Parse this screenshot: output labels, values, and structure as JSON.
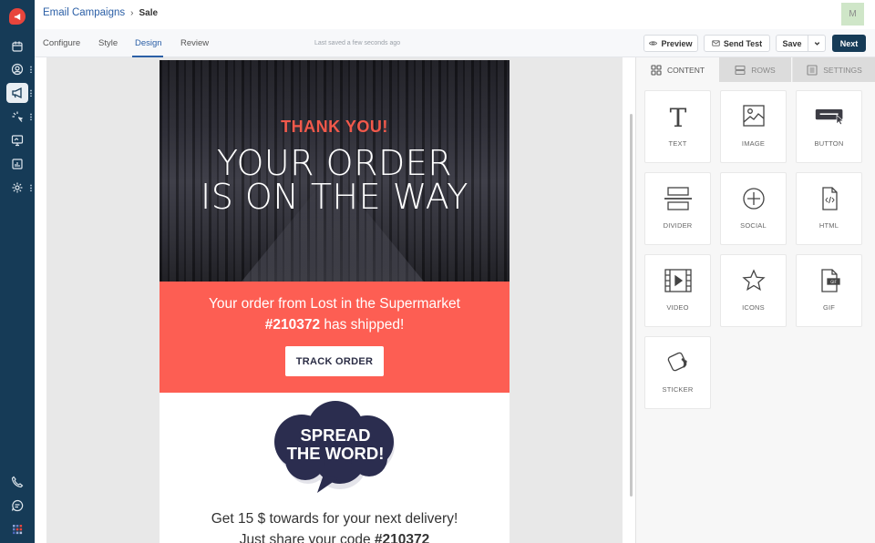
{
  "nav": {
    "logo": "megaphone-logo",
    "items": [
      {
        "icon": "calendar-icon",
        "has_menu": false
      },
      {
        "icon": "contacts-icon",
        "has_menu": true
      },
      {
        "icon": "campaigns-icon",
        "has_menu": true,
        "active": true
      },
      {
        "icon": "automation-icon",
        "has_menu": true
      },
      {
        "icon": "sites-icon",
        "has_menu": false
      },
      {
        "icon": "reports-icon",
        "has_menu": false
      },
      {
        "icon": "settings-icon",
        "has_menu": true
      }
    ],
    "bottom": [
      {
        "icon": "phone-icon"
      },
      {
        "icon": "chat-icon"
      },
      {
        "icon": "apps-grid-icon"
      }
    ]
  },
  "header": {
    "breadcrumb_parent": "Email Campaigns",
    "breadcrumb_current": "Sale",
    "avatar_initial": "M"
  },
  "tabs": [
    {
      "label": "Configure"
    },
    {
      "label": "Style"
    },
    {
      "label": "Design",
      "active": true
    },
    {
      "label": "Review"
    }
  ],
  "status": "Last saved a few seconds ago",
  "actions": {
    "preview": "Preview",
    "send_test": "Send Test",
    "save": "Save",
    "next": "Next"
  },
  "email": {
    "thanks": "THANK YOU!",
    "headline_1": "YOUR ORDER",
    "headline_2": "IS ON THE WAY",
    "msg_line1": "Your order from Lost in the Supermarket",
    "order_no": "#210372",
    "msg_line2_rest": " has shipped!",
    "track_button": "TRACK ORDER",
    "spread_1": "SPREAD",
    "spread_2": "THE WORD!",
    "share_line1": "Get 15 $ towards for your next delivery!",
    "share_line2_prefix": "Just share your code ",
    "share_code": "#210372",
    "colors": {
      "accent": "#fd5e53",
      "thanks": "#f2594b",
      "cloud": "#2b2d4f"
    }
  },
  "panel": {
    "tabs": [
      {
        "label": "CONTENT",
        "active": true
      },
      {
        "label": "ROWS"
      },
      {
        "label": "SETTINGS"
      }
    ],
    "blocks": [
      {
        "label": "TEXT"
      },
      {
        "label": "IMAGE"
      },
      {
        "label": "BUTTON"
      },
      {
        "label": "DIVIDER"
      },
      {
        "label": "SOCIAL"
      },
      {
        "label": "HTML"
      },
      {
        "label": "VIDEO"
      },
      {
        "label": "ICONS"
      },
      {
        "label": "GIF"
      },
      {
        "label": "STICKER"
      }
    ]
  }
}
